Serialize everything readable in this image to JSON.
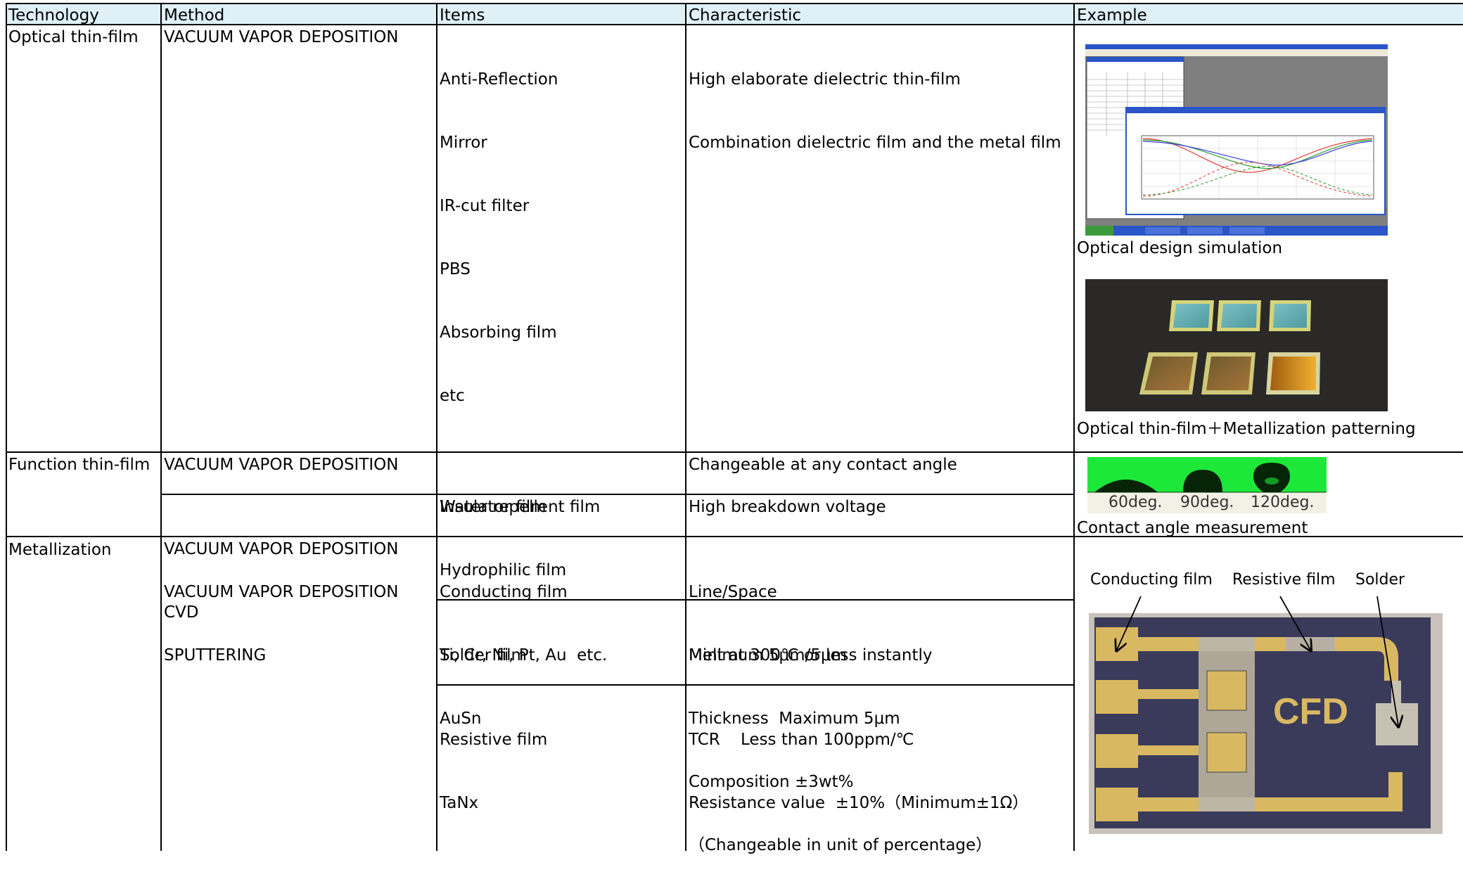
{
  "header": {
    "technology": "Technology",
    "method": "Method",
    "items": "Items",
    "characteristic": "Characteristic",
    "example": "Example"
  },
  "rows": {
    "optical": {
      "technology": "Optical thin-film",
      "method": "VACUUM VAPOR DEPOSITION",
      "items": [
        "Anti-Reflection",
        "Mirror",
        "IR-cut filter",
        "PBS",
        "Absorbing film",
        "etc"
      ],
      "characteristic": [
        "High elaborate dielectric thin-film",
        "Combination dielectric film and the metal film"
      ],
      "example_captions": [
        "Optical design simulation",
        "Optical thin-film＋Metallization patterning"
      ]
    },
    "function": {
      "technology": "Function thin-film",
      "sub1": {
        "method": "VACUUM VAPOR DEPOSITION",
        "items": [
          "Water repellent film",
          "Hydrophilic film"
        ],
        "characteristic": "Changeable at any contact angle"
      },
      "sub2": {
        "method": [
          "VACUUM VAPOR DEPOSITION",
          "CVD"
        ],
        "items": "Insulator film",
        "characteristic": "High breakdown voltage"
      },
      "angle_labels": [
        "60deg.",
        "90deg.",
        "120deg."
      ],
      "example_caption": "Contact angle measurement"
    },
    "metallization": {
      "technology": "Metallization",
      "method": [
        "VACUUM VAPOR DEPOSITION",
        "SPUTTERING"
      ],
      "sub1": {
        "items": [
          "Conducting film",
          "Ti, Cr, Ni, Pt, Au  etc."
        ],
        "characteristic": [
          "Line/Space",
          "Minimum 5μm/5μm"
        ]
      },
      "sub2": {
        "items": [
          "Solder film",
          "AuSn"
        ],
        "characteristic": [
          "Melt at 300℃ or less instantly",
          "Thickness  Maximum 5μm",
          "Composition ±3wt%",
          "（Changeable in unit of percentage）"
        ]
      },
      "sub3": {
        "items": [
          "Resistive film",
          "TaNx"
        ],
        "characteristic": [
          "TCR    Less than 100ppm/℃",
          "Resistance value  ±10%（Minimum±1Ω）"
        ]
      },
      "diagram_labels": [
        "Conducting film",
        "Resistive film",
        "Solder"
      ],
      "chip_text": "CFD"
    }
  }
}
